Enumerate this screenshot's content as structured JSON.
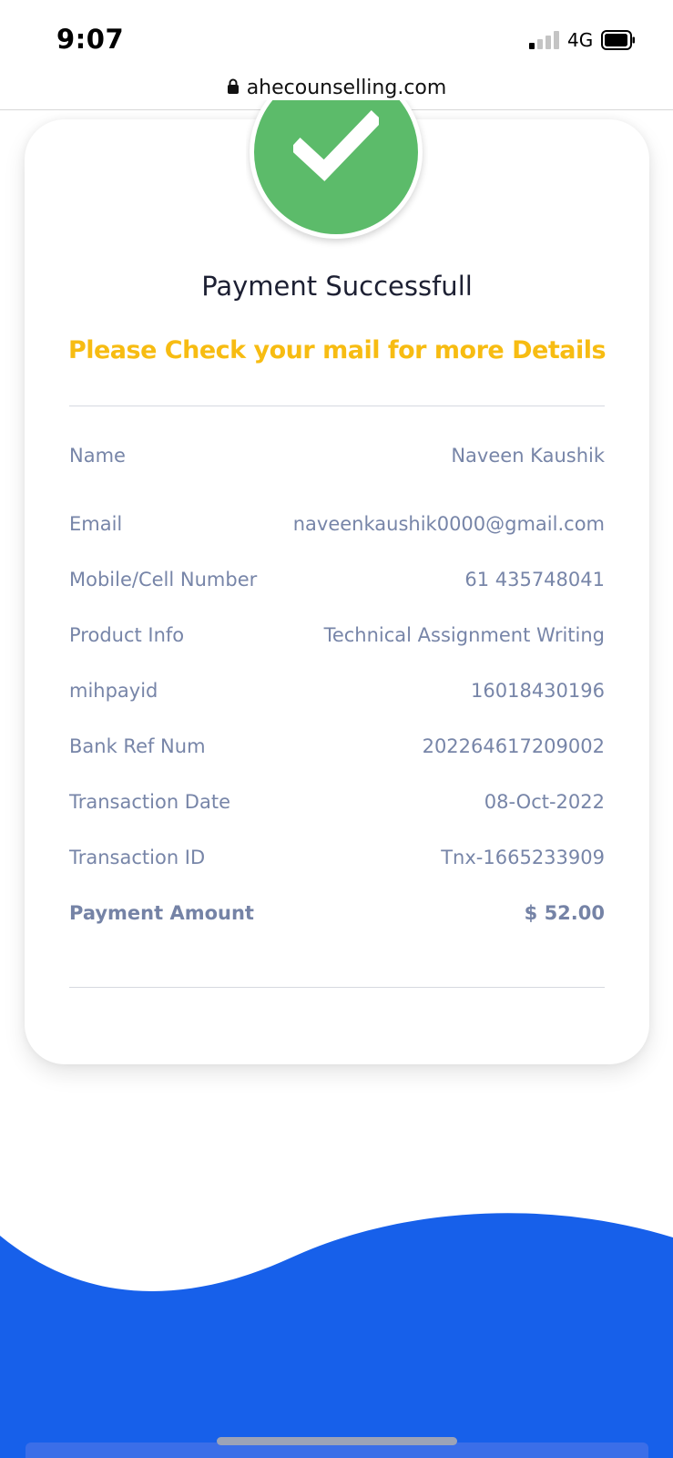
{
  "status_bar": {
    "time": "9:07",
    "network": "4G"
  },
  "browser": {
    "url": "ahecounselling.com"
  },
  "payment": {
    "title": "Payment Successfull",
    "subtitle": "Please Check your mail for more Details",
    "details": [
      {
        "label": "Name",
        "value": "Naveen Kaushik"
      },
      {
        "label": "Email",
        "value": "naveenkaushik0000@gmail.com"
      },
      {
        "label": "Mobile/Cell Number",
        "value": "61 435748041"
      },
      {
        "label": "Product Info",
        "value": "Technical Assignment Writing"
      },
      {
        "label": "mihpayid",
        "value": "16018430196"
      },
      {
        "label": "Bank Ref Num",
        "value": "202264617209002"
      },
      {
        "label": "Transaction Date",
        "value": "08-Oct-2022"
      },
      {
        "label": "Transaction ID",
        "value": "Tnx-1665233909"
      }
    ],
    "amount": {
      "label": "Payment Amount",
      "value": "$ 52.00"
    }
  },
  "colors": {
    "success_green": "#5cbb6a",
    "highlight_yellow": "#f7bc12",
    "text_muted": "#7785a8",
    "wave_blue": "#1760ea"
  },
  "icons": [
    "signal-icon",
    "battery-icon",
    "lock-icon",
    "checkmark-icon"
  ]
}
